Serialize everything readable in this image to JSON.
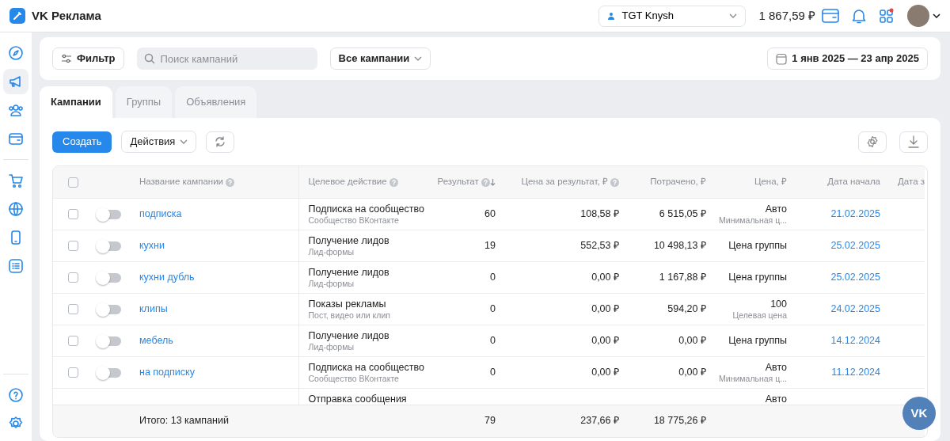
{
  "header": {
    "logo_text": "VK Реклама",
    "account": "TGT Knysh",
    "balance": "1 867,59 ₽",
    "apps_notification": true
  },
  "sidebar": {
    "items": [
      {
        "kind": "compass",
        "selected": false
      },
      {
        "kind": "megaphone",
        "selected": true
      },
      {
        "kind": "people",
        "selected": false
      },
      {
        "kind": "wallet",
        "selected": false
      },
      {
        "kind": "cart",
        "selected": false
      },
      {
        "kind": "globe",
        "selected": false
      },
      {
        "kind": "phone",
        "selected": false
      },
      {
        "kind": "list",
        "selected": false
      }
    ],
    "bottom_items": [
      {
        "kind": "help",
        "selected": false
      },
      {
        "kind": "settings",
        "selected": false
      }
    ]
  },
  "filter_bar": {
    "filter_button": "Фильтр",
    "search_placeholder": "Поиск кампаний",
    "scope": "Все кампании",
    "date_range": "1 янв 2025 — 23 апр 2025"
  },
  "tabs": [
    {
      "label": "Кампании",
      "selected": true
    },
    {
      "label": "Группы",
      "selected": false
    },
    {
      "label": "Объявления",
      "selected": false
    }
  ],
  "actions": {
    "create": "Создать",
    "actions": "Действия"
  },
  "table": {
    "select_all_checked": false,
    "columns": [
      {
        "label": "Название кампании",
        "help": true,
        "sorted": false
      },
      {
        "label": "Целевое действие",
        "help": true,
        "sorted": false
      },
      {
        "label": "Результат",
        "help": true,
        "sorted": true
      },
      {
        "label": "Цена за результат, ₽",
        "help": true,
        "sorted": false
      },
      {
        "label": "Потрачено, ₽",
        "help": false,
        "sorted": false
      },
      {
        "label": "Цена, ₽",
        "help": false,
        "sorted": false
      },
      {
        "label": "Дата начала",
        "help": false,
        "sorted": false
      },
      {
        "label": "Дата з",
        "help": false,
        "sorted": false
      }
    ],
    "rows": [
      {
        "checked": false,
        "on": false,
        "name": "подписка",
        "action": "Подписка на сообщество",
        "action_sub": "Сообщество ВКонтакте",
        "result": "60",
        "cpr": "108,58 ₽",
        "spent": "6 515,05 ₽",
        "price": "Авто",
        "price_sub": "Минимальная ц...",
        "start": "21.02.2025"
      },
      {
        "checked": false,
        "on": false,
        "name": "кухни",
        "action": "Получение лидов",
        "action_sub": "Лид-формы",
        "result": "19",
        "cpr": "552,53 ₽",
        "spent": "10 498,13 ₽",
        "price": "Цена группы",
        "start": "25.02.2025"
      },
      {
        "checked": false,
        "on": false,
        "name": "кухни дубль",
        "action": "Получение лидов",
        "action_sub": "Лид-формы",
        "result": "0",
        "cpr": "0,00 ₽",
        "spent": "1 167,88 ₽",
        "price": "Цена группы",
        "start": "25.02.2025"
      },
      {
        "checked": false,
        "on": false,
        "name": "клипы",
        "action": "Показы рекламы",
        "action_sub": "Пост, видео или клип",
        "result": "0",
        "cpr": "0,00 ₽",
        "spent": "594,20 ₽",
        "price": "100",
        "price_sub": "Целевая цена",
        "start": "24.02.2025"
      },
      {
        "checked": false,
        "on": false,
        "name": "мебель",
        "action": "Получение лидов",
        "action_sub": "Лид-формы",
        "result": "0",
        "cpr": "0,00 ₽",
        "spent": "0,00 ₽",
        "price": "Цена группы",
        "start": "14.12.2024"
      },
      {
        "checked": false,
        "on": false,
        "name": "на подписку",
        "action": "Подписка на сообщество",
        "action_sub": "Сообщество ВКонтакте",
        "result": "0",
        "cpr": "0,00 ₽",
        "spent": "0,00 ₽",
        "price": "Авто",
        "price_sub": "Минимальная ц...",
        "start": "11.12.2024"
      },
      {
        "action": "Отправка сообщения",
        "price": "Авто"
      }
    ],
    "total": {
      "label": "Итого: 13 кампаний",
      "result": "79",
      "cpr": "237,66 ₽",
      "spent": "18 775,26 ₽"
    }
  },
  "chat_button": "VK"
}
